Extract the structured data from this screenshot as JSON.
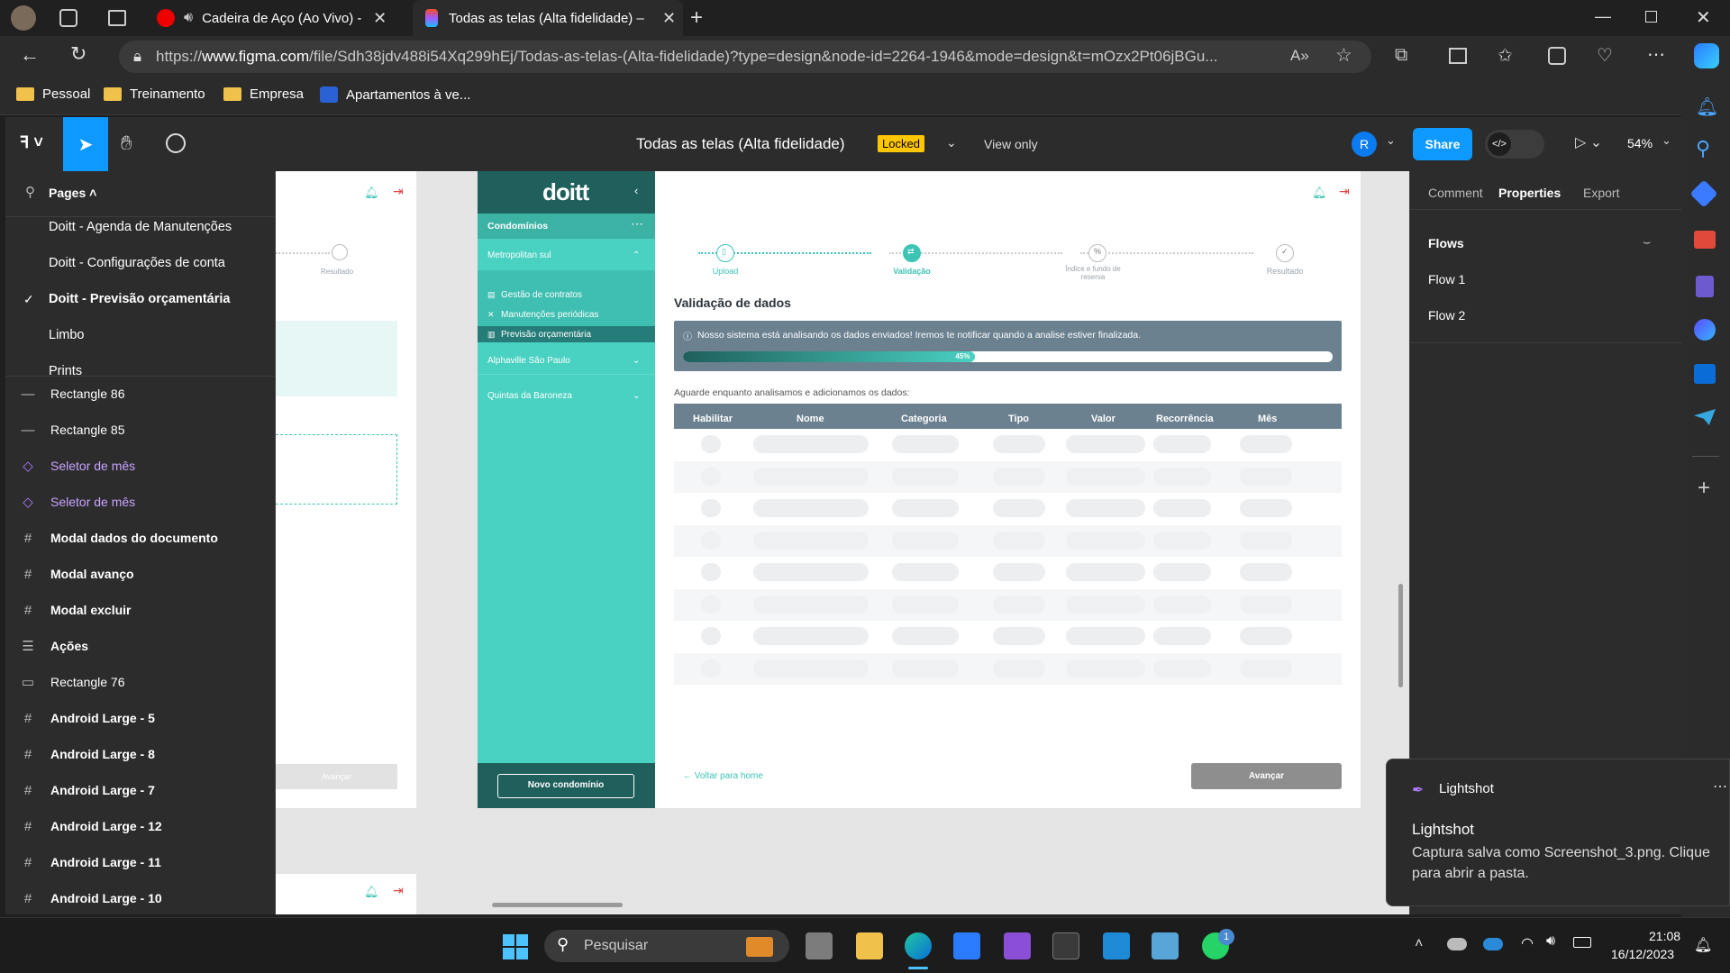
{
  "browser": {
    "tabs": [
      {
        "title": "Cadeira de Aço (Ao Vivo) - Y"
      },
      {
        "title": "Todas as telas (Alta fidelidade) – "
      }
    ],
    "url_prefix": "https://",
    "url_domain": "www.figma.com",
    "url_rest": "/file/Sdh38jdv488i54Xq299hEj/Todas-as-telas-(Alta-fidelidade)?type=design&node-id=2264-1946&mode=design&t=mOzx2Pt06jBGu...",
    "bookmarks": [
      "Pessoal",
      "Treinamento",
      "Empresa",
      "Apartamentos à ve..."
    ]
  },
  "figma": {
    "file_title": "Todas as telas (Alta fidelidade)",
    "locked_badge": "Locked",
    "view_only": "View only",
    "avatar_initial": "R",
    "share_label": "Share",
    "zoom": "54%",
    "pages_label": "Pages",
    "pages": [
      "Doitt - Agenda de Manutenções",
      "Doitt - Configurações de conta",
      "Doitt - Previsão orçamentária",
      "Limbo",
      "Prints"
    ],
    "current_page": "Doitt - Previsão orçamentária",
    "layers": [
      {
        "name": "Rectangle 86",
        "icon": "line",
        "component": false
      },
      {
        "name": "Rectangle 85",
        "icon": "line",
        "component": false
      },
      {
        "name": "Seletor de mês",
        "icon": "diamond",
        "component": true
      },
      {
        "name": "Seletor de mês",
        "icon": "diamond",
        "component": true
      },
      {
        "name": "Modal dados do documento",
        "icon": "frame",
        "component": false
      },
      {
        "name": "Modal avanço",
        "icon": "frame",
        "component": false
      },
      {
        "name": "Modal excluir",
        "icon": "frame",
        "component": false
      },
      {
        "name": "Ações",
        "icon": "autolayout",
        "component": false
      },
      {
        "name": "Rectangle 76",
        "icon": "rect",
        "component": false
      },
      {
        "name": "Android Large - 5",
        "icon": "frame",
        "component": false
      },
      {
        "name": "Android Large - 8",
        "icon": "frame",
        "component": false
      },
      {
        "name": "Android Large - 7",
        "icon": "frame",
        "component": false
      },
      {
        "name": "Android Large - 12",
        "icon": "frame",
        "component": false
      },
      {
        "name": "Android Large - 11",
        "icon": "frame",
        "component": false
      },
      {
        "name": "Android Large - 10",
        "icon": "frame",
        "component": false
      }
    ],
    "right_tabs": [
      "Comment",
      "Properties",
      "Export"
    ],
    "flows_label": "Flows",
    "flows": [
      "Flow 1",
      "Flow 2"
    ]
  },
  "design": {
    "logo": "doitt",
    "sidebar_header": "Condomínios",
    "groups": [
      "Metropolitan sul",
      "Alphaville São Paulo",
      "Quintas da Baroneza"
    ],
    "sub_items": [
      "Gestão de contratos",
      "Manutenções periódicas",
      "Previsão orçamentária"
    ],
    "new_button": "Novo condomínio",
    "steps": [
      "Upload",
      "Validação",
      "Índice e fundo de reserva",
      "Resultado"
    ],
    "section_title": "Validação de dados",
    "alert_text": "Nosso sistema está analisando os dados enviados! Iremos te notificar quando a analise estiver finalizada.",
    "progress": 0.45,
    "progress_label": "45%",
    "wait_text": "Aguarde enquanto analisamos e adicionamos os dados:",
    "table_headers": [
      "Habilitar",
      "Nome",
      "Categoria",
      "Tipo",
      "Valor",
      "Recorrência",
      "Mês"
    ],
    "back_link": "Voltar para home",
    "next_button": "Avançar",
    "left_frame_step": "Resultado",
    "left_frame_button": "Avançar"
  },
  "notification": {
    "app": "Lightshot",
    "title": "Lightshot",
    "body": "Captura salva como Screenshot_3.png. Clique para abrir a pasta."
  },
  "taskbar": {
    "search_placeholder": "Pesquisar",
    "time": "21:08",
    "date": "16/12/2023",
    "whatsapp_badge": "1"
  },
  "colors": {
    "teal": "#49d1c1",
    "dark_teal": "#1f5f5c",
    "figma_blue": "#0d99ff",
    "locked_yellow": "#ffc700"
  }
}
